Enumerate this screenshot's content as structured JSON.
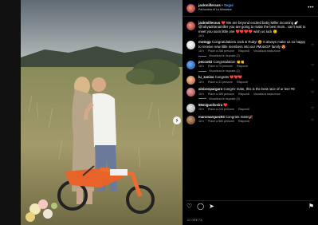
{
  "window": {
    "close_icon": "close-icon"
  },
  "post": {
    "username": "jackmilleraus",
    "follow_label": "Segui",
    "location": "Parrocchia di La Mossana",
    "caption_user": "jackmilleraus",
    "caption_text": "❤️ We are beyond excited baby Miller incoming 🍼 @rubyadrianamiller you are going to make the best mum.. can't wait to meet you soon little one ❤️❤️❤️❤️ wish us luck 😊",
    "caption_meta": "18 h",
    "date": "12 ORE FA"
  },
  "comments": [
    {
      "user": "motogp",
      "text": "Congratulations Jack & Ruby! 🤩 It always make us so happy to receive new little members into our #MotoGP family 😍",
      "time": "18 h",
      "likes": "Piace a 288 persone",
      "reply": "Rispondi",
      "translate": "Visualizza traduzione",
      "replies": "Visualizza le risposte (2)"
    },
    {
      "user": "pecco63",
      "text": "Congratulation 👏👏",
      "time": "18 h",
      "likes": "Piace a 73 persone",
      "reply": "Rispondi",
      "translate": "",
      "replies": "Visualizza le risposte (2)"
    },
    {
      "user": "lu_zaniss",
      "text": "Congrats ❤️❤️❤️",
      "time": "18 h",
      "likes": "Piace a 31 persone",
      "reply": "Rispondi",
      "translate": "",
      "replies": ""
    },
    {
      "user": "aleixespargaro",
      "text": "Congrtz mate, this is the best race of ur lee! #9",
      "time": "18 h",
      "likes": "Piace a 485 persone",
      "reply": "Rispondi",
      "translate": "Visualizza traduzione",
      "replies": "Visualizza le risposte (3)"
    },
    {
      "user": "88miguoliveira",
      "text": "❤️",
      "time": "18 h",
      "likes": "Piace a 224 persone",
      "reply": "Rispondi",
      "translate": "",
      "replies": ""
    },
    {
      "user": "marcmarquez93",
      "text": "Congrats mate!🎉",
      "time": "18 h",
      "likes": "Piace a 580 persone",
      "reply": "Rispondi",
      "translate": "",
      "replies": ""
    }
  ],
  "actions": {
    "like_icon": "heart-icon",
    "comment_icon": "comment-icon",
    "share_icon": "share-icon",
    "save_icon": "bookmark-icon"
  },
  "navigation": {
    "next_icon": "chevron-right-icon"
  }
}
